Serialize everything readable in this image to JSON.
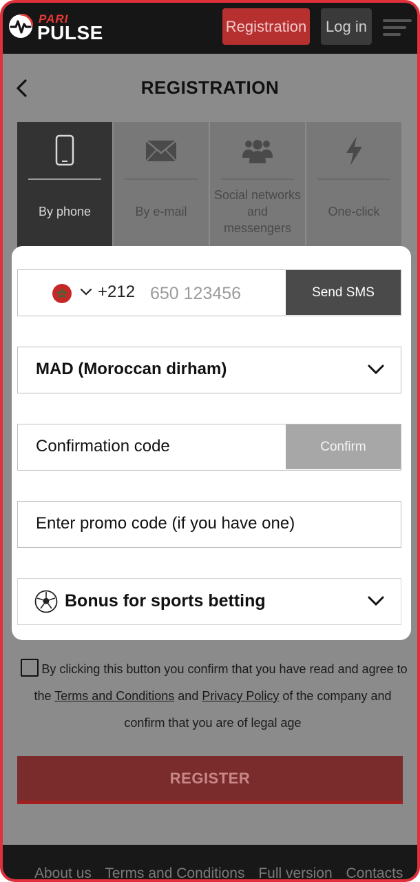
{
  "header": {
    "logo_top": "PARI",
    "logo_bottom": "PULSE",
    "registration_label": "Registration",
    "login_label": "Log in",
    "icons": {
      "menu": "hamburger-menu-icon",
      "back": "chevron-left-icon"
    }
  },
  "page": {
    "title": "REGISTRATION"
  },
  "tabs": [
    {
      "label": "By phone",
      "icon": "phone-icon",
      "active": true
    },
    {
      "label": "By e-mail",
      "icon": "envelope-icon",
      "active": false
    },
    {
      "label": "Social networks and messengers",
      "icon": "users-icon",
      "active": false
    },
    {
      "label": "One-click",
      "icon": "lightning-icon",
      "active": false
    }
  ],
  "form": {
    "phone": {
      "country_code": "+212",
      "placeholder": "650 123456",
      "send_label": "Send SMS",
      "flag": "morocco-flag-icon"
    },
    "currency": {
      "value": "MAD (Moroccan dirham)"
    },
    "confirmation": {
      "placeholder": "Confirmation code",
      "confirm_label": "Confirm"
    },
    "promo": {
      "placeholder": "Enter promo code (if you have one)"
    },
    "bonus": {
      "value": "Bonus for sports betting",
      "icon": "soccer-ball-icon"
    }
  },
  "agreement": {
    "before": "By clicking this button you confirm that you have read and agree to the ",
    "terms_link": "Terms and Conditions",
    "middle": " and ",
    "privacy_link": "Privacy Policy",
    "after": " of the company and confirm that you are of legal age"
  },
  "register_label": "REGISTER",
  "footer": {
    "links": [
      "About us",
      "Terms and Conditions",
      "Full version",
      "Contacts"
    ]
  },
  "colors": {
    "accent": "#e0303c",
    "topbar": "#161616",
    "overlay": "#8b8b8b"
  }
}
